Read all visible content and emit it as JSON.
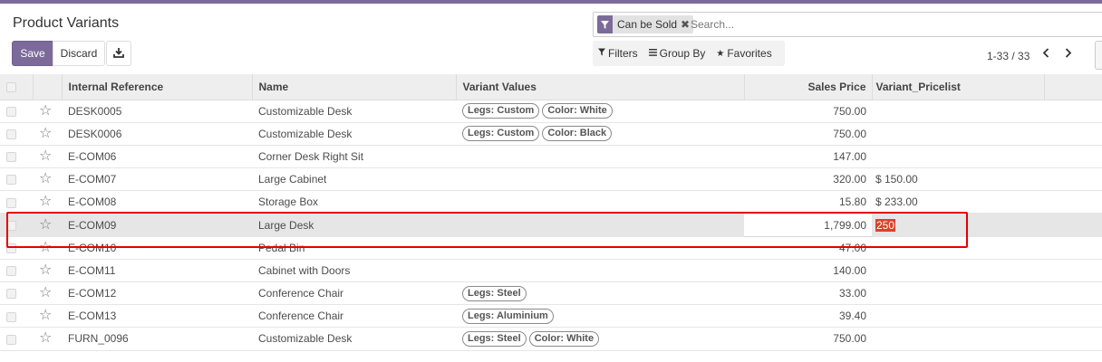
{
  "header": {
    "title": "Product Variants",
    "save_label": "Save",
    "discard_label": "Discard",
    "download_icon": "download-icon"
  },
  "search": {
    "facet_icon": "filter-icon",
    "facet_label": "Can be Sold",
    "facet_remove": "✖",
    "placeholder": "Search...",
    "value": ""
  },
  "filters": {
    "filters_label": "Filters",
    "group_by_label": "Group By",
    "favorites_label": "Favorites"
  },
  "pager": {
    "text": "1-33 / 33"
  },
  "columns": {
    "internal_reference": "Internal Reference",
    "name": "Name",
    "variant_values": "Variant Values",
    "sales_price": "Sales Price",
    "variant_pricelist": "Variant_Pricelist"
  },
  "rows": [
    {
      "ref": "DESK0005",
      "name": "Customizable Desk",
      "tags": [
        "Legs: Custom",
        "Color: White"
      ],
      "price": "750.00",
      "pricelist": ""
    },
    {
      "ref": "DESK0006",
      "name": "Customizable Desk",
      "tags": [
        "Legs: Custom",
        "Color: Black"
      ],
      "price": "750.00",
      "pricelist": ""
    },
    {
      "ref": "E-COM06",
      "name": "Corner Desk Right Sit",
      "tags": [],
      "price": "147.00",
      "pricelist": ""
    },
    {
      "ref": "E-COM07",
      "name": "Large Cabinet",
      "tags": [],
      "price": "320.00",
      "pricelist": "$ 150.00"
    },
    {
      "ref": "E-COM08",
      "name": "Storage Box",
      "tags": [],
      "price": "15.80",
      "pricelist": "$ 233.00"
    },
    {
      "ref": "E-COM09",
      "name": "Large Desk",
      "tags": [],
      "price": "1,799.00",
      "pricelist": "250",
      "selected": true
    },
    {
      "ref": "E-COM10",
      "name": "Pedal Bin",
      "tags": [],
      "price": "47.00",
      "pricelist": ""
    },
    {
      "ref": "E-COM11",
      "name": "Cabinet with Doors",
      "tags": [],
      "price": "140.00",
      "pricelist": ""
    },
    {
      "ref": "E-COM12",
      "name": "Conference Chair",
      "tags": [
        "Legs: Steel"
      ],
      "price": "33.00",
      "pricelist": ""
    },
    {
      "ref": "E-COM13",
      "name": "Conference Chair",
      "tags": [
        "Legs: Aluminium"
      ],
      "price": "39.40",
      "pricelist": ""
    },
    {
      "ref": "FURN_0096",
      "name": "Customizable Desk",
      "tags": [
        "Legs: Steel",
        "Color: White"
      ],
      "price": "750.00",
      "pricelist": ""
    }
  ],
  "colors": {
    "brand": "#7c6b9a",
    "highlight": "#e60000",
    "edit_value_bg": "#d9432a"
  }
}
